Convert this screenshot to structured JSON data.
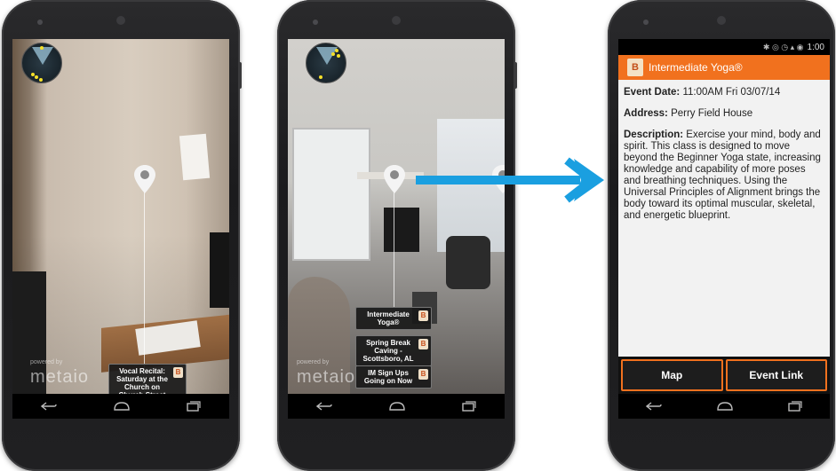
{
  "screen1": {
    "poi_cards": [
      {
        "label": "Vocal Recital: Saturday at the Church on Church Street",
        "logo": "B"
      }
    ],
    "watermark": {
      "powered_by": "powered by",
      "brand": "metaio"
    }
  },
  "screen2": {
    "poi_cards": [
      {
        "label": "Intermediate Yoga®",
        "logo": "B"
      },
      {
        "label": "Spring Break Caving - Scottsboro, AL",
        "logo": "B"
      },
      {
        "label": "IM Sign Ups Going on Now",
        "logo": "B"
      }
    ],
    "watermark": {
      "powered_by": "powered by",
      "brand": "metaio"
    }
  },
  "screen3": {
    "status_time": "1:00",
    "app_logo": "B",
    "title": "Intermediate Yoga®",
    "event_date_label": "Event Date:",
    "event_date_value": "11:00AM Fri 03/07/14",
    "address_label": "Address:",
    "address_value": "Perry Field House",
    "description_label": "Description:",
    "description_value": "Exercise your mind, body and spirit. This class is designed to move beyond the Beginner Yoga state, increasing knowledge and capability of more poses and breathing techniques. Using the Universal Principles of Alignment brings the body toward its optimal muscular, skeletal, and energetic blueprint.",
    "map_button": "Map",
    "event_link_button": "Event Link"
  },
  "colors": {
    "accent": "#f1711e",
    "arrow": "#1a9fe0",
    "radar_dot": "#f5e02a"
  },
  "icons": [
    "radar-icon",
    "location-pin-icon",
    "back-icon",
    "home-icon",
    "recent-apps-icon",
    "arrow-right-icon"
  ]
}
